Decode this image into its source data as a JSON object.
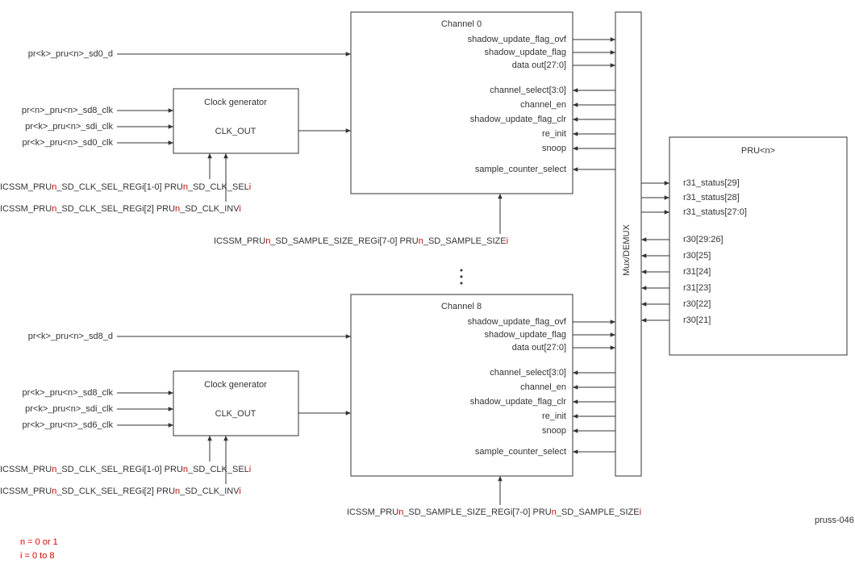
{
  "signals_in_top": [
    "pr<k>_pru<n>_sd0_d"
  ],
  "clk_inputs_top": [
    "pr<n>_pru<n>_sd8_clk",
    "pr<k>_pru<n>_sdi_clk",
    "pr<k>_pru<n>_sd0_clk"
  ],
  "signals_in_bot": [
    "pr<k>_pru<n>_sd8_d"
  ],
  "clk_inputs_bot": [
    "pr<k>_pru<n>_sd8_clk",
    "pr<k>_pru<n>_sdi_clk",
    "pr<k>_pru<n>_sd6_clk"
  ],
  "clock_gen": {
    "title": "Clock generator",
    "out": "CLK_OUT"
  },
  "clk_sel_regs": [
    {
      "pre": "ICSSM_PRU",
      "n": "n",
      "mid": "_SD_CLK_SEL_REGi[1-0] PRU",
      "n2": "n",
      "suf": "_SD_CLK_SEL",
      "i": "i"
    },
    {
      "pre": "ICSSM_PRU",
      "n": "n",
      "mid": "_SD_CLK_SEL_REGi[2] PRU",
      "n2": "n",
      "suf": "_SD_CLK_INV",
      "i": "i"
    }
  ],
  "sample_reg": {
    "pre": "ICSSM_PRU",
    "n": "n",
    "mid": "_SD_SAMPLE_SIZE_REGi[7-0] PRU",
    "n2": "n",
    "suf": "_SD_SAMPLE_SIZE",
    "i": "i"
  },
  "channel": {
    "title0": "Channel 0",
    "title8": "Channel 8",
    "outs": [
      "shadow_update_flag_ovf",
      "shadow_update_flag",
      "data out[27:0]"
    ],
    "ins": [
      "channel_select[3:0]",
      "channel_en",
      "shadow_update_flag_clr",
      "re_init",
      "snoop",
      "sample_counter_select"
    ]
  },
  "mux": "Mux/DEMUX",
  "pru": {
    "title": "PRU<n>",
    "outs": [
      "r31_status[29]",
      "r31_status[28]",
      "r31_status[27:0]"
    ],
    "ins": [
      "r30[29:26]",
      "r30[25]",
      "r31[24]",
      "r31[23]",
      "r30[22]",
      "r30[21]"
    ]
  },
  "note1": "n = 0 or 1",
  "note2": "i = 0 to 8",
  "footer": "pruss-046"
}
